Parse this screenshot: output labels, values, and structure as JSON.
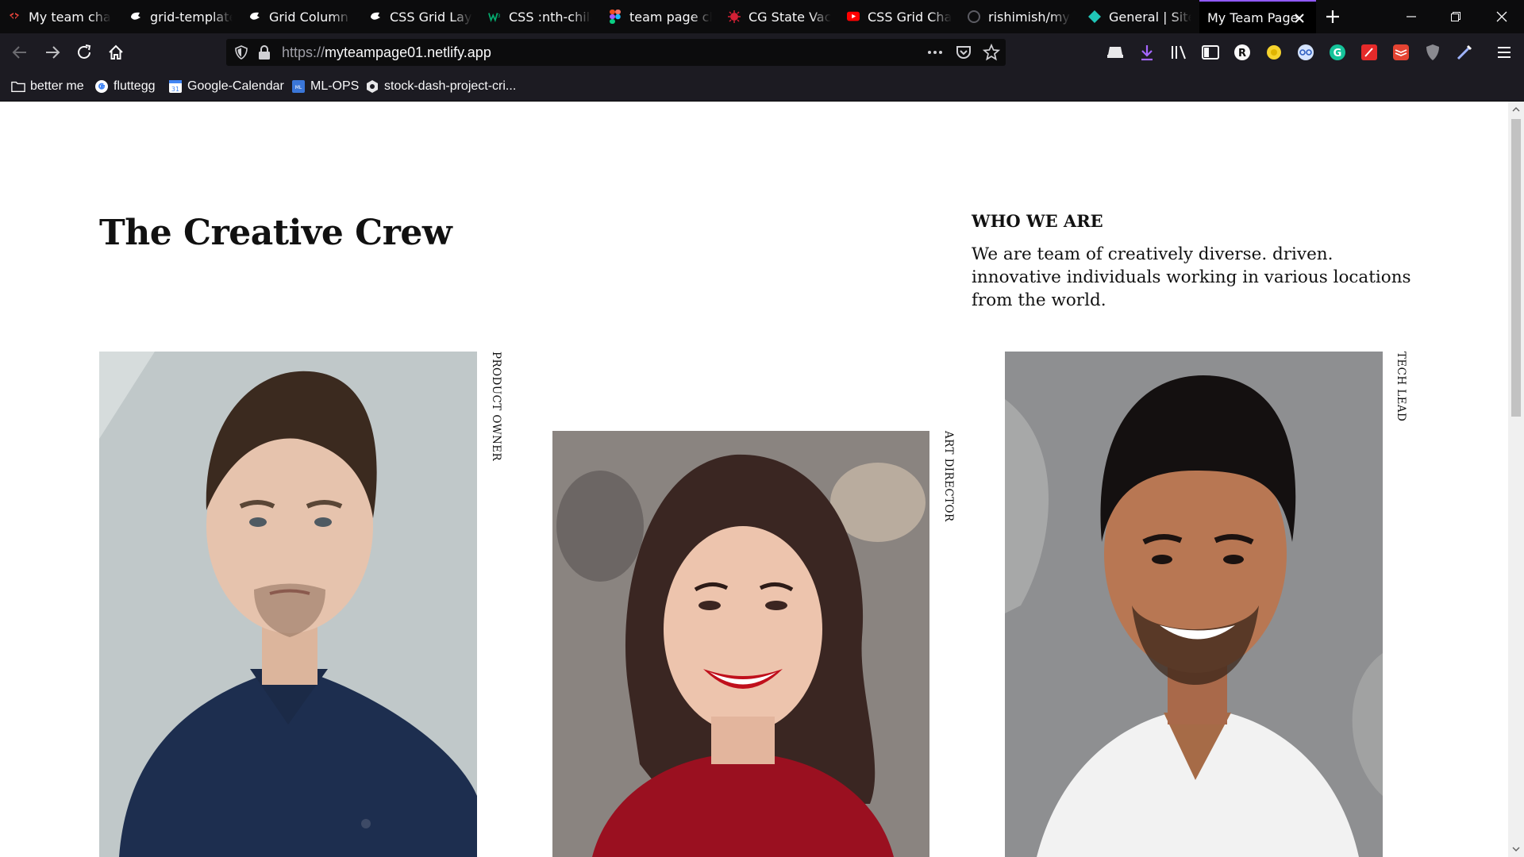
{
  "browser": {
    "tabs": [
      {
        "title": "My team challenge",
        "icon": "frontend-mentor-icon",
        "active": false
      },
      {
        "title": "grid-template-areas",
        "icon": "css-tricks-icon",
        "active": false
      },
      {
        "title": "Grid Column - Tailwind",
        "icon": "css-tricks-icon",
        "active": false
      },
      {
        "title": "CSS Grid Layout",
        "icon": "css-tricks-icon",
        "active": false
      },
      {
        "title": "CSS :nth-child() Selector",
        "icon": "w3schools-icon",
        "active": false
      },
      {
        "title": "team page challenge",
        "icon": "figma-icon",
        "active": false
      },
      {
        "title": "CG State Vaccine",
        "icon": "virus-icon",
        "active": false
      },
      {
        "title": "CSS Grid Changes",
        "icon": "youtube-icon",
        "active": false
      },
      {
        "title": "rishimish/my-team",
        "icon": "github-icon",
        "active": false
      },
      {
        "title": "General | Site settings",
        "icon": "netlify-icon",
        "active": false
      },
      {
        "title": "My Team Page",
        "icon": "",
        "active": true
      }
    ],
    "url": {
      "protocol": "https://",
      "host": "myteampage01.netlify.app"
    },
    "bookmarks": [
      {
        "label": "better me",
        "icon": "folder-icon"
      },
      {
        "label": "fluttegg",
        "icon": "google-icon"
      },
      {
        "label": "Google-Calendar",
        "icon": "calendar-icon"
      },
      {
        "label": "ML-OPS",
        "icon": "ml-icon"
      },
      {
        "label": "stock-dash-project-cri...",
        "icon": "github-icon"
      }
    ],
    "accent": "#9059ff"
  },
  "page": {
    "headline": "The Creative Crew",
    "about": {
      "title": "WHO WE ARE",
      "text": "We are team of creatively diverse. driven. innovative individuals working in various locations from the world."
    },
    "members": [
      {
        "role": "PRODUCT OWNER",
        "photo": "man-in-navy-polo-portrait"
      },
      {
        "role": "ART DIRECTOR",
        "photo": "woman-in-red-sweater-smiling-portrait"
      },
      {
        "role": "TECH LEAD",
        "photo": "man-in-white-tshirt-smiling-portrait"
      }
    ]
  }
}
